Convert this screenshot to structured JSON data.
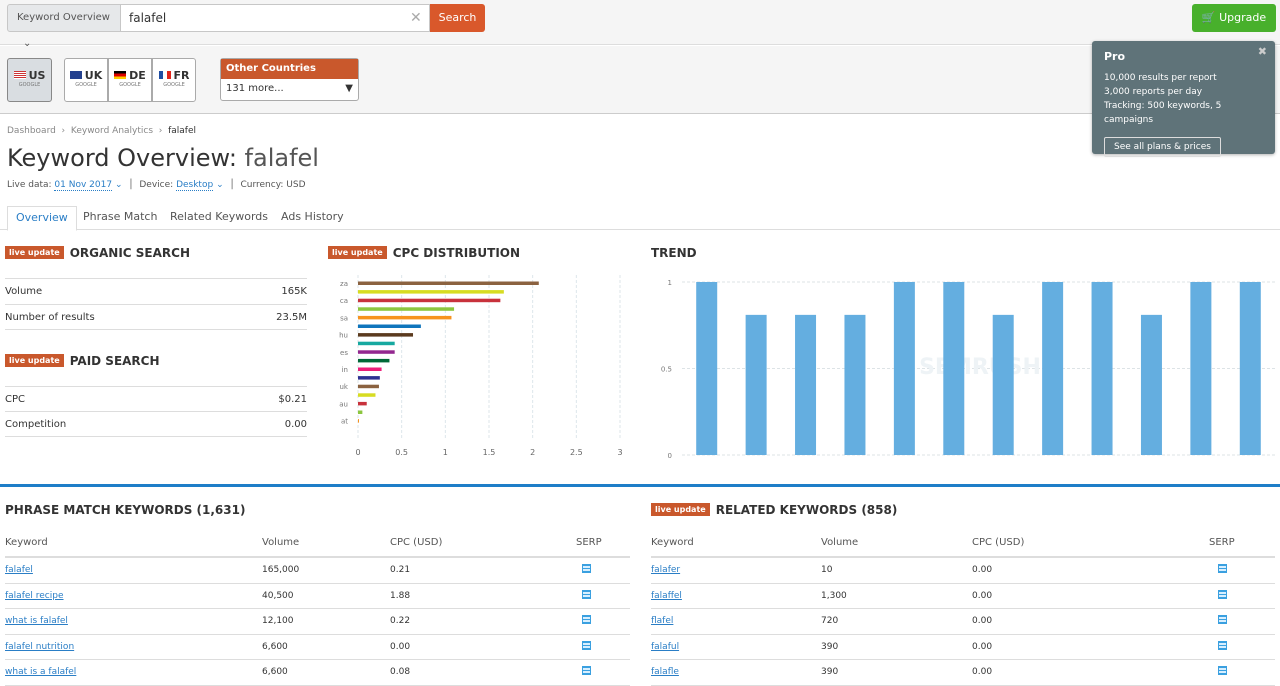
{
  "topbar": {
    "db_select": "Keyword Overview",
    "query": "falafel",
    "search_label": "Search",
    "upgrade_label": "Upgrade"
  },
  "countries": [
    {
      "code": "US",
      "engine": "GOOGLE",
      "active": true
    },
    {
      "code": "UK",
      "engine": "GOOGLE"
    },
    {
      "code": "DE",
      "engine": "GOOGLE"
    },
    {
      "code": "FR",
      "engine": "GOOGLE"
    }
  ],
  "other_countries": {
    "title": "Other Countries",
    "value": "131 more..."
  },
  "popup": {
    "title": "Pro",
    "lines": [
      "10,000 results per report",
      "3,000 reports per day",
      "Tracking: 500 keywords, 5 campaigns"
    ],
    "button": "See all plans & prices"
  },
  "breadcrumb": [
    "Dashboard",
    "Keyword Analytics",
    "falafel"
  ],
  "page": {
    "title_prefix": "Keyword Overview:",
    "keyword": "falafel",
    "live_label": "Live data:",
    "live_date": "01 Nov 2017",
    "device_label": "Device:",
    "device": "Desktop",
    "currency": "Currency: USD"
  },
  "tabs": [
    "Overview",
    "Phrase Match",
    "Related Keywords",
    "Ads History"
  ],
  "badge": "live update",
  "organic": {
    "title": "ORGANIC SEARCH",
    "rows": [
      {
        "k": "Volume",
        "v": "165K"
      },
      {
        "k": "Number of results",
        "v": "23.5M"
      }
    ]
  },
  "paid": {
    "title": "PAID SEARCH",
    "rows": [
      {
        "k": "CPC",
        "v": "$0.21"
      },
      {
        "k": "Competition",
        "v": "0.00"
      }
    ]
  },
  "chart_data": [
    {
      "type": "bar",
      "orientation": "horizontal",
      "title": "CPC DISTRIBUTION",
      "category_labels": [
        "za",
        "",
        "ca",
        "",
        "sa",
        "",
        "hu",
        "",
        "es",
        "",
        "in",
        "",
        "uk",
        "",
        "au",
        "",
        "at"
      ],
      "values": [
        2.07,
        1.67,
        1.63,
        1.1,
        1.07,
        0.72,
        0.63,
        0.42,
        0.42,
        0.36,
        0.27,
        0.25,
        0.24,
        0.2,
        0.1,
        0.05,
        0.01
      ],
      "colors": [
        "#8b6240",
        "#d7dc22",
        "#c8323c",
        "#8cc63f",
        "#f7931e",
        "#0f75bc",
        "#5b3a1e",
        "#17a9a0",
        "#93278f",
        "#006837",
        "#ec1e79",
        "#2e3192",
        "#8b6240",
        "#d7dc22",
        "#c8323c",
        "#8cc63f",
        "#f7931e"
      ],
      "xlim": [
        0,
        3
      ],
      "xticks": [
        "0",
        "0.5",
        "1",
        "1.5",
        "2",
        "2.5",
        "3"
      ],
      "grid": true
    },
    {
      "type": "bar",
      "title": "TREND",
      "values": [
        1,
        0.81,
        0.81,
        0.81,
        1,
        1,
        0.81,
        1,
        1,
        0.81,
        1,
        1
      ],
      "ylim": [
        0,
        1
      ],
      "yticks": [
        "0",
        "0.5",
        "1"
      ],
      "color": "#64aee0",
      "grid": true
    }
  ],
  "phrase": {
    "title": "PHRASE MATCH KEYWORDS (1,631)",
    "headers": [
      "Keyword",
      "Volume",
      "CPC (USD)",
      "SERP"
    ],
    "rows": [
      [
        "falafel",
        "165,000",
        "0.21"
      ],
      [
        "falafel recipe",
        "40,500",
        "1.88"
      ],
      [
        "what is falafel",
        "12,100",
        "0.22"
      ],
      [
        "falafel nutrition",
        "6,600",
        "0.00"
      ],
      [
        "what is a falafel",
        "6,600",
        "0.08"
      ]
    ]
  },
  "related": {
    "title": "RELATED KEYWORDS (858)",
    "headers": [
      "Keyword",
      "Volume",
      "CPC (USD)",
      "SERP"
    ],
    "rows": [
      [
        "falafer",
        "10",
        "0.00"
      ],
      [
        "falaffel",
        "1,300",
        "0.00"
      ],
      [
        "flafel",
        "720",
        "0.00"
      ],
      [
        "falaful",
        "390",
        "0.00"
      ],
      [
        "falafle",
        "390",
        "0.00"
      ]
    ]
  }
}
